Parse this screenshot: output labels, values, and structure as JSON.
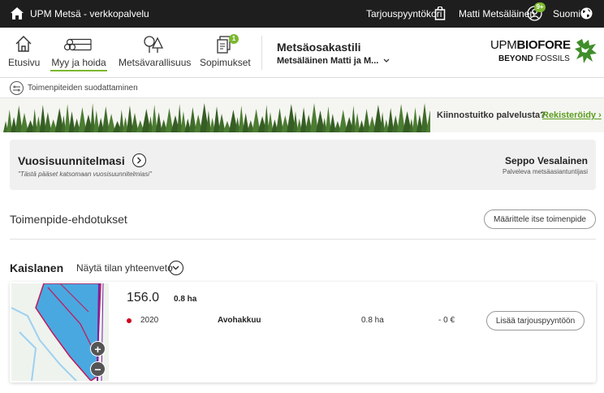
{
  "topbar": {
    "brand": "UPM Metsä - verkkopalvelu",
    "cart_label": "Tarjouspyyntökori",
    "user_label": "Matti Metsäläinen",
    "user_badge": "9+",
    "language": "Suomi"
  },
  "nav": {
    "items": [
      {
        "label": "Etusivu",
        "icon": "home-icon"
      },
      {
        "label": "Myy ja hoida",
        "icon": "logs-icon",
        "active": true
      },
      {
        "label": "Metsävarallisuus",
        "icon": "trees-icon"
      },
      {
        "label": "Sopimukset",
        "icon": "documents-icon",
        "badge": "1"
      }
    ],
    "account_title": "Metsäosakastili",
    "account_owner": "Metsäläinen Matti ja M..."
  },
  "logo": {
    "line1_a": "UPM",
    "line1_b": "BIOFORE",
    "line2_a": "BEYOND",
    "line2_b": "FOSSILS"
  },
  "filter": {
    "label": "Toimenpiteiden suodattaminen"
  },
  "banner": {
    "question": "Kiinnostuitko palvelusta?",
    "register": "Rekisteröidy ›"
  },
  "plan": {
    "title": "Vuosisuunnitelmasi",
    "subtitle": "\"Tästä pääset katsomaan vuosisuunnitelmiasi\"",
    "advisor_name": "Seppo Vesalainen",
    "advisor_role": "Palveleva metsäasiantuntijasi"
  },
  "suggestions": {
    "title": "Toimenpide-ehdotukset",
    "button": "Määrittele itse toimenpide"
  },
  "estate": {
    "name": "Kaislanen",
    "summary_toggle": "Näytä tilan yhteenveto"
  },
  "stand": {
    "id": "156.0",
    "area": "0.8 ha",
    "operation": {
      "year": "2020",
      "type": "Avohakkuu",
      "area": "0.8 ha",
      "value": "- 0 €",
      "button": "Lisää tarjouspyyntöön"
    },
    "zoom_in": "+",
    "zoom_out": "−"
  },
  "colors": {
    "accent": "#7cb82f",
    "topbar": "#1e1e1e",
    "status_dot": "#d0021b",
    "map_stand": "#4aa8e0"
  }
}
